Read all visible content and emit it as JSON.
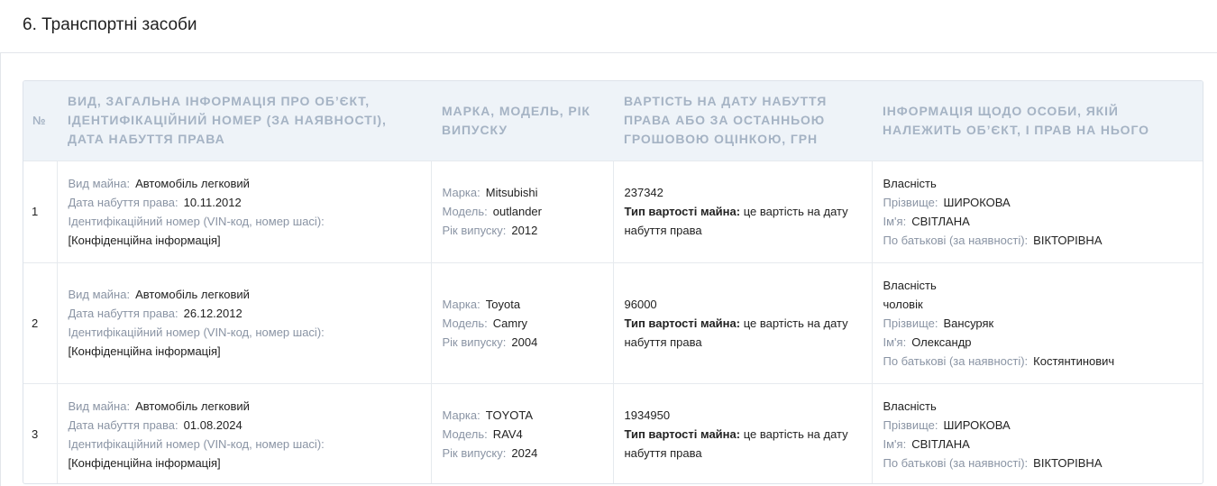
{
  "section": {
    "title": "6. Транспортні засоби"
  },
  "table": {
    "headers": {
      "no": "№",
      "object": "Вид, загальна інформація про об’єкт, ідентифікаційний номер (за наявності), дата набуття права",
      "model": "Марка, модель, рік випуску",
      "value": "Вартість на дату набуття права або за останньою грошовою оцінкою, грн",
      "owner": "Інформація щодо особи, якій належить об’єкт, і прав на нього"
    },
    "labels": {
      "property_type": "Вид майна:",
      "acq_date": "Дата набуття права:",
      "vin": "Ідентифікаційний номер (VIN-код, номер шасі):",
      "brand": "Марка:",
      "model": "Модель:",
      "year": "Рік випуску:",
      "value_type": "Тип вартості майна:",
      "surname": "Прізвище:",
      "name": "Ім'я:",
      "patronymic": "По батькові (за наявності):"
    },
    "rows": [
      {
        "no": "1",
        "property_type": "Автомобіль легковий",
        "acq_date": "10.11.2012",
        "vin": "[Конфіденційна інформація]",
        "brand": "Mitsubishi",
        "model": "outlander",
        "year": "2012",
        "amount": "237342",
        "value_type": "це вартість на дату набуття права",
        "right": "Власність",
        "relation": "",
        "surname": "ШИРОКОВА",
        "name": "СВІТЛАНА",
        "patronymic": "ВІКТОРІВНА"
      },
      {
        "no": "2",
        "property_type": "Автомобіль легковий",
        "acq_date": "26.12.2012",
        "vin": "[Конфіденційна інформація]",
        "brand": "Toyota",
        "model": "Camry",
        "year": "2004",
        "amount": "96000",
        "value_type": "це вартість на дату набуття права",
        "right": "Власність",
        "relation": "чоловік",
        "surname": "Вансуряк",
        "name": "Олександр",
        "patronymic": "Костянтинович"
      },
      {
        "no": "3",
        "property_type": "Автомобіль легковий",
        "acq_date": "01.08.2024",
        "vin": "[Конфіденційна інформація]",
        "brand": "TOYOTA",
        "model": "RAV4",
        "year": "2024",
        "amount": "1934950",
        "value_type": "це вартість на дату набуття права",
        "right": "Власність",
        "relation": "",
        "surname": "ШИРОКОВА",
        "name": "СВІТЛАНА",
        "patronymic": "ВІКТОРІВНА"
      }
    ]
  }
}
